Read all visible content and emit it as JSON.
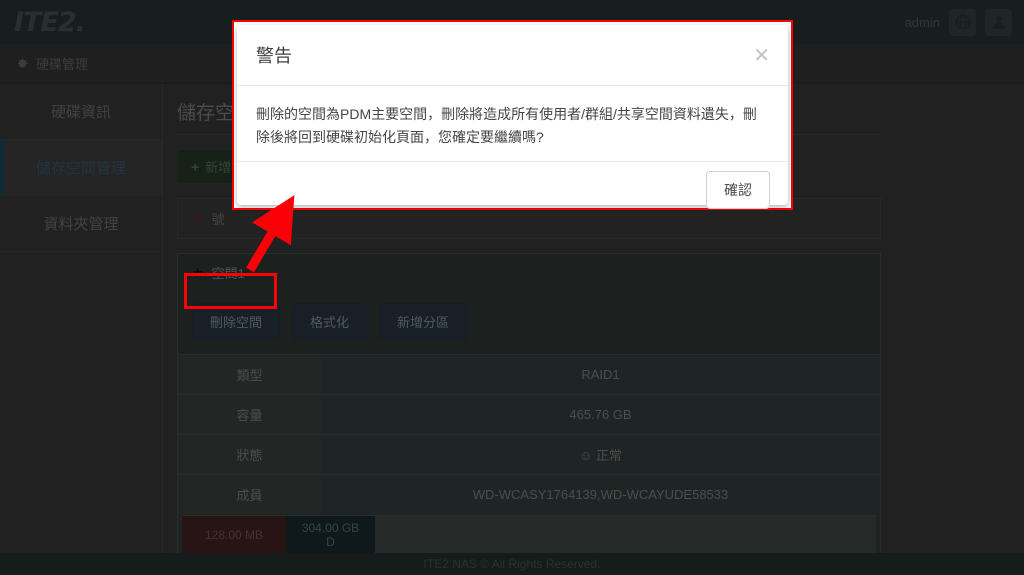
{
  "header": {
    "logo_text": "ITE2.",
    "admin_label": "admin",
    "language_icon": "globe-icon",
    "user_icon": "user-icon"
  },
  "breadcrumb": {
    "gear_icon": "gear-icon",
    "label": "硬碟管理"
  },
  "sidebar": {
    "items": [
      {
        "label": "硬碟資訊",
        "active": false
      },
      {
        "label": "儲存空間管理",
        "active": true
      },
      {
        "label": "資料夾管理",
        "active": false
      }
    ]
  },
  "main": {
    "page_title": "儲存空間管理",
    "new_button": {
      "icon": "plus-icon",
      "label": "新增"
    },
    "group_card": {
      "star_icon": "star-icon",
      "label": "號"
    },
    "space_card": {
      "star_icon": "star-icon",
      "title": "空間1",
      "actions": [
        {
          "label": "刪除空間",
          "highlighted": true
        },
        {
          "label": "格式化",
          "highlighted": false
        },
        {
          "label": "新增分區",
          "highlighted": false
        }
      ],
      "details": [
        {
          "key": "類型",
          "value": "RAID1"
        },
        {
          "key": "容量",
          "value": "465.76 GB"
        },
        {
          "key": "狀態",
          "value": "☺ 正常"
        },
        {
          "key": "成員",
          "value": "WD-WCASY1764139,WD-WCAYUDE58533"
        }
      ],
      "partitions": [
        {
          "size": "128.00 MB",
          "letter": "",
          "color": "#4a2525"
        },
        {
          "size": "304.00 GB",
          "letter": "D",
          "color": "#1d2e33"
        }
      ]
    }
  },
  "footer": {
    "text": "ITE2 NAS © All Rights Reserved."
  },
  "modal": {
    "title": "警告",
    "close_icon": "close-icon",
    "message": "刪除的空間為PDM主要空間，刪除將造成所有使用者/群組/共享空間資料遺失，刪除後將回到硬碟初始化頁面，您確定要繼續嗎?",
    "confirm_label": "確認"
  },
  "annotations": {
    "highlight_color": "#fb0007",
    "arrow_from": "刪除空間",
    "arrow_to": "警告"
  }
}
